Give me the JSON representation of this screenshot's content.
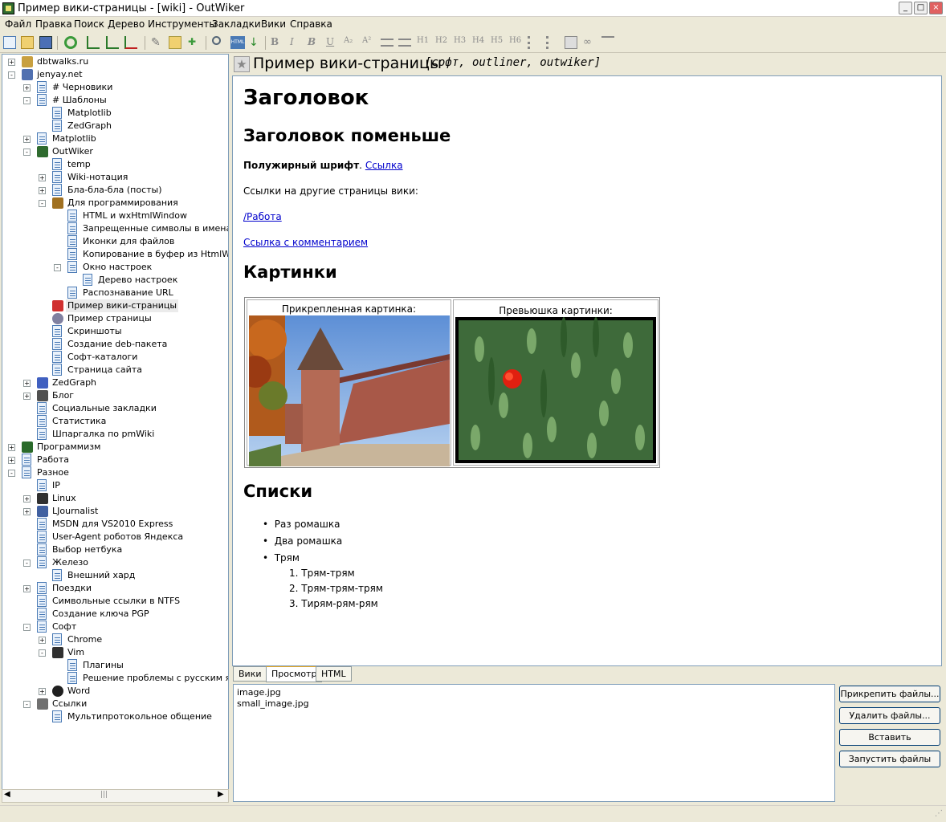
{
  "window": {
    "title": "Пример вики-страницы - [wiki] - OutWiker"
  },
  "menu": [
    "Файл",
    "Правка",
    "Поиск",
    "Дерево",
    "Инструменты",
    "Закладки",
    "Вики",
    "Справка"
  ],
  "toolbar": {
    "headings": [
      "H1",
      "H2",
      "H3",
      "H4",
      "H5",
      "H6"
    ],
    "bold": "B",
    "italic": "I",
    "underline": "U",
    "subscript": "A₂",
    "superscript": "A²"
  },
  "tree": [
    {
      "label": "dbtwalks.ru",
      "level": 0,
      "exp": "+",
      "icon": "bookmark-icon"
    },
    {
      "label": "jenyay.net",
      "level": 0,
      "exp": "-",
      "icon": "user-icon"
    },
    {
      "label": "# Черновики",
      "level": 1,
      "exp": "+",
      "icon": "page-icon"
    },
    {
      "label": "# Шаблоны",
      "level": 1,
      "exp": "-",
      "icon": "page-icon"
    },
    {
      "label": "Matplotlib",
      "level": 2,
      "exp": "",
      "icon": "page-icon"
    },
    {
      "label": "ZedGraph",
      "level": 2,
      "exp": "",
      "icon": "page-icon"
    },
    {
      "label": "Matplotlib",
      "level": 1,
      "exp": "+",
      "icon": "page-icon"
    },
    {
      "label": "OutWiker",
      "level": 1,
      "exp": "-",
      "icon": "outwiker-icon"
    },
    {
      "label": "temp",
      "level": 2,
      "exp": "",
      "icon": "page-icon"
    },
    {
      "label": "Wiki-нотация",
      "level": 2,
      "exp": "+",
      "icon": "page-icon"
    },
    {
      "label": "Бла-бла-бла (посты)",
      "level": 2,
      "exp": "+",
      "icon": "page-icon"
    },
    {
      "label": "Для программирования",
      "level": 2,
      "exp": "-",
      "icon": "wand-icon"
    },
    {
      "label": "HTML и wxHtmlWindow",
      "level": 3,
      "exp": "",
      "icon": "page-icon"
    },
    {
      "label": "Запрещенные символы в именах фа",
      "level": 3,
      "exp": "",
      "icon": "page-icon"
    },
    {
      "label": "Иконки для файлов",
      "level": 3,
      "exp": "",
      "icon": "page-icon"
    },
    {
      "label": "Копирование в буфер из HtmlWindo",
      "level": 3,
      "exp": "",
      "icon": "page-icon"
    },
    {
      "label": "Окно настроек",
      "level": 3,
      "exp": "-",
      "icon": "page-icon"
    },
    {
      "label": "Дерево настроек",
      "level": 4,
      "exp": "",
      "icon": "page-icon"
    },
    {
      "label": "Распознавание URL",
      "level": 3,
      "exp": "",
      "icon": "page-icon"
    },
    {
      "label": "Пример вики-страницы",
      "level": 2,
      "exp": "",
      "icon": "flag-icon",
      "selected": true
    },
    {
      "label": "Пример страницы",
      "level": 2,
      "exp": "",
      "icon": "disk-icon"
    },
    {
      "label": "Скриншоты",
      "level": 2,
      "exp": "",
      "icon": "page-icon"
    },
    {
      "label": "Создание deb-пакета",
      "level": 2,
      "exp": "",
      "icon": "page-icon"
    },
    {
      "label": "Софт-каталоги",
      "level": 2,
      "exp": "",
      "icon": "page-icon"
    },
    {
      "label": "Страница сайта",
      "level": 2,
      "exp": "",
      "icon": "page-icon"
    },
    {
      "label": "ZedGraph",
      "level": 1,
      "exp": "+",
      "icon": "chart-icon"
    },
    {
      "label": "Блог",
      "level": 1,
      "exp": "+",
      "icon": "list-icon"
    },
    {
      "label": "Социальные закладки",
      "level": 1,
      "exp": "",
      "icon": "page-icon"
    },
    {
      "label": "Статистика",
      "level": 1,
      "exp": "",
      "icon": "page-icon"
    },
    {
      "label": "Шпаргалка по pmWiki",
      "level": 1,
      "exp": "",
      "icon": "page-icon"
    },
    {
      "label": "Программизм",
      "level": 0,
      "exp": "+",
      "icon": "chip-icon"
    },
    {
      "label": "Работа",
      "level": 0,
      "exp": "+",
      "icon": "page-icon"
    },
    {
      "label": "Разное",
      "level": 0,
      "exp": "-",
      "icon": "page-icon"
    },
    {
      "label": "IP",
      "level": 1,
      "exp": "",
      "icon": "page-icon"
    },
    {
      "label": "Linux",
      "level": 1,
      "exp": "+",
      "icon": "linux-icon"
    },
    {
      "label": "LJournalist",
      "level": 1,
      "exp": "+",
      "icon": "pencil-icon"
    },
    {
      "label": "MSDN для VS2010 Express",
      "level": 1,
      "exp": "",
      "icon": "page-icon"
    },
    {
      "label": "User-Agent роботов Яндекса",
      "level": 1,
      "exp": "",
      "icon": "page-icon"
    },
    {
      "label": "Выбор нетбука",
      "level": 1,
      "exp": "",
      "icon": "page-icon"
    },
    {
      "label": "Железо",
      "level": 1,
      "exp": "-",
      "icon": "page-icon"
    },
    {
      "label": "Внешний хард",
      "level": 2,
      "exp": "",
      "icon": "page-icon"
    },
    {
      "label": "Поездки",
      "level": 1,
      "exp": "+",
      "icon": "page-icon"
    },
    {
      "label": "Символьные ссылки в NTFS",
      "level": 1,
      "exp": "",
      "icon": "page-icon"
    },
    {
      "label": "Создание ключа PGP",
      "level": 1,
      "exp": "",
      "icon": "page-icon"
    },
    {
      "label": "Софт",
      "level": 1,
      "exp": "-",
      "icon": "page-icon"
    },
    {
      "label": "Chrome",
      "level": 2,
      "exp": "+",
      "icon": "page-icon"
    },
    {
      "label": "Vim",
      "level": 2,
      "exp": "-",
      "icon": "linux-icon"
    },
    {
      "label": "Плагины",
      "level": 3,
      "exp": "",
      "icon": "page-icon"
    },
    {
      "label": "Решение проблемы с русским языко",
      "level": 3,
      "exp": "",
      "icon": "page-icon"
    },
    {
      "label": "Word",
      "level": 2,
      "exp": "+",
      "icon": "bomb-icon"
    },
    {
      "label": "Ссылки",
      "level": 1,
      "exp": "-",
      "icon": "link-icon"
    },
    {
      "label": "Мультипротокольное общение",
      "level": 2,
      "exp": "",
      "icon": "page-icon"
    }
  ],
  "page": {
    "title": "Пример вики-страницы",
    "tags": "[софт, outliner, outwiker]",
    "h1": "Заголовок",
    "h2_small": "Заголовок поменьше",
    "bold_text": "Полужирный шрифт",
    "bold_after": ".",
    "link1": "Ссылка",
    "links_intro": "Ссылки на другие страницы вики:",
    "link_work": "/Работа",
    "link_comment": "Ссылка с комментарием",
    "h2_pictures": "Картинки",
    "caption_attached": "Прикрепленная картинка:",
    "caption_thumb": "Превьюшка картинки:",
    "h2_lists": "Списки",
    "bullets": [
      "Раз ромашка",
      "Два ромашка",
      "Трям"
    ],
    "numbered": [
      "Трям-трям",
      "Трям-трям-трям",
      "Тирям-рям-рям"
    ]
  },
  "tabs": [
    "Вики",
    "Просмотр",
    "HTML"
  ],
  "files": [
    "image.jpg",
    "small_image.jpg"
  ],
  "file_buttons": {
    "attach": "Прикрепить файлы...",
    "delete": "Удалить файлы...",
    "insert": "Вставить",
    "run": "Запустить файлы"
  },
  "colors": {
    "link": "#0000cc",
    "selection": "#ebebeb",
    "border": "#7f9db9"
  }
}
